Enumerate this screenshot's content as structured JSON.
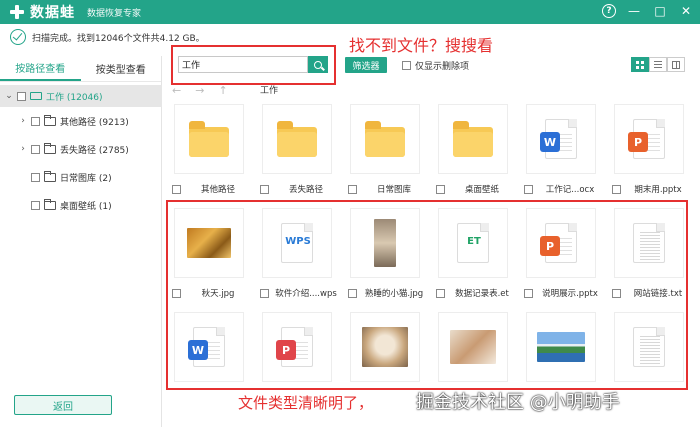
{
  "titlebar": {
    "app_name": "数据蛙",
    "subtitle": "数据恢复专家",
    "controls": [
      "?",
      "—",
      "□",
      "✕"
    ]
  },
  "status": {
    "text": "扫描完成。找到12046个文件共4.12 GB。"
  },
  "sidebar": {
    "tabs": [
      {
        "label": "按路径查看",
        "active": true
      },
      {
        "label": "按类型查看",
        "active": false
      }
    ],
    "root": {
      "label": "工作 (12046)"
    },
    "items": [
      {
        "label": "其他路径 (9213)",
        "expandable": true
      },
      {
        "label": "丢失路径 (2785)",
        "expandable": true
      },
      {
        "label": "日常图库 (2)",
        "expandable": false
      },
      {
        "label": "桌面壁纸 (1)",
        "expandable": false
      }
    ],
    "back_label": "返回"
  },
  "toolbar": {
    "search_value": "工作",
    "filter_label": "筛选器",
    "show_deleted_label": "仅显示删除项"
  },
  "breadcrumb": {
    "current": "工作"
  },
  "annotations": {
    "top": "找不到文件？搜搜看",
    "bottom": "文件类型清晰明了，",
    "watermark": "掘金技术社区 @小明助手"
  },
  "files": [
    {
      "name": "其他路径",
      "kind": "folder"
    },
    {
      "name": "丢失路径",
      "kind": "folder"
    },
    {
      "name": "日常图库",
      "kind": "folder"
    },
    {
      "name": "桌面壁纸",
      "kind": "folder"
    },
    {
      "name": "工作记...ocx",
      "kind": "word"
    },
    {
      "name": "期末用.pptx",
      "kind": "ppt"
    },
    {
      "name": "秋天.jpg",
      "kind": "photo-autumn"
    },
    {
      "name": "软件介绍....wps",
      "kind": "wps"
    },
    {
      "name": "熟睡的小猫.jpg",
      "kind": "photo-cat-tall"
    },
    {
      "name": "数据记录表.et",
      "kind": "et"
    },
    {
      "name": "说明展示.pptx",
      "kind": "ppt"
    },
    {
      "name": "网站链接.txt",
      "kind": "txt"
    },
    {
      "name": "",
      "kind": "word"
    },
    {
      "name": "",
      "kind": "pdf"
    },
    {
      "name": "",
      "kind": "photo-cat"
    },
    {
      "name": "",
      "kind": "photo-rabbit"
    },
    {
      "name": "",
      "kind": "photo-lake"
    },
    {
      "name": "",
      "kind": "txt"
    }
  ]
}
